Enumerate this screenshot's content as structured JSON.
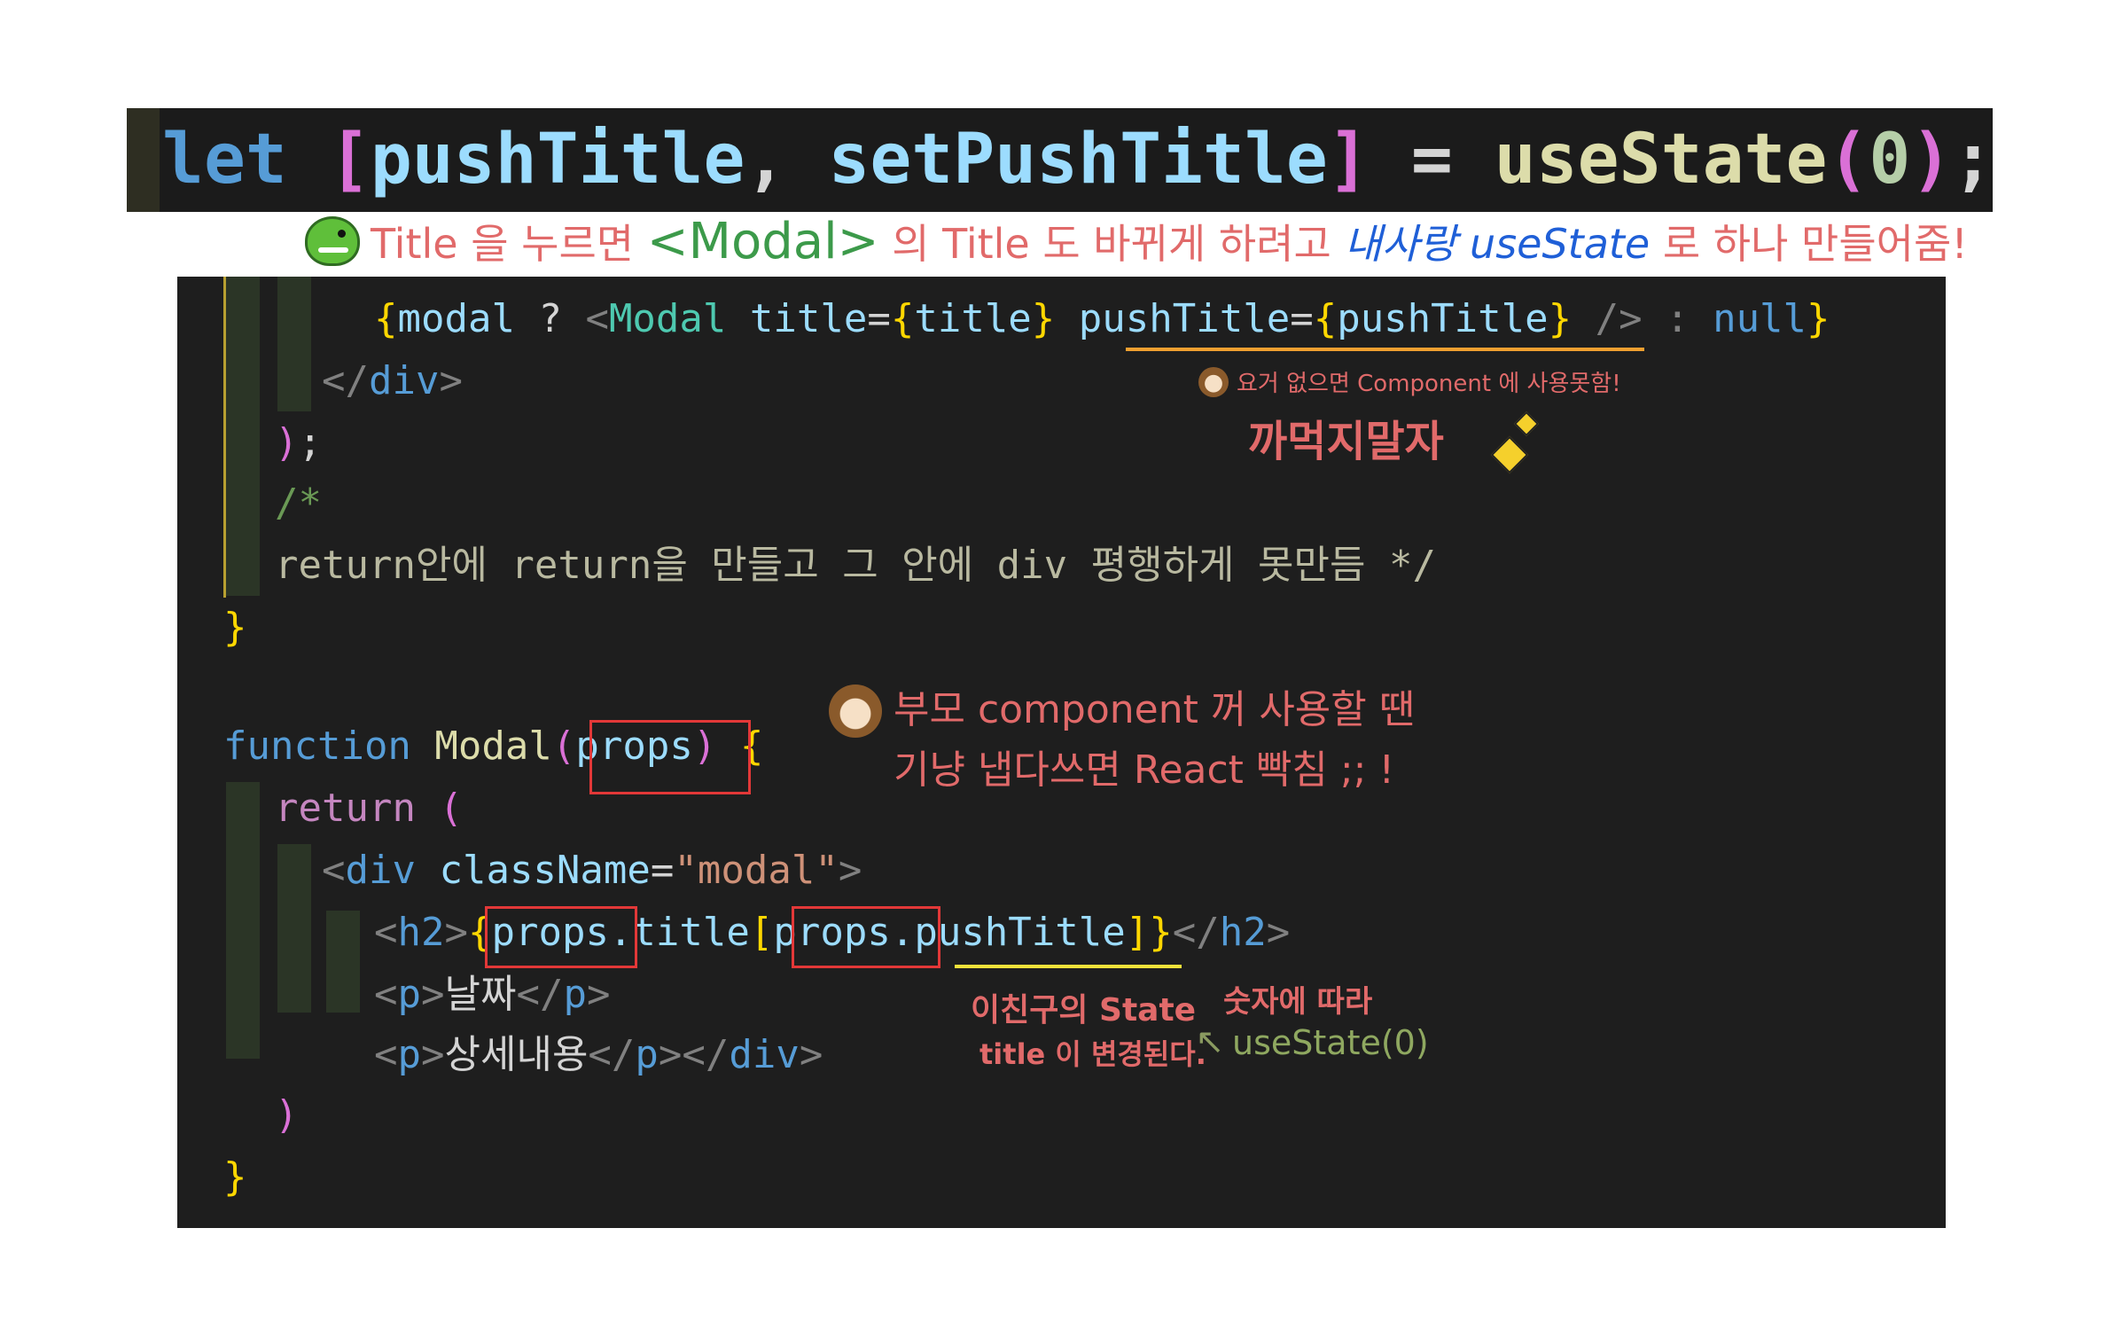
{
  "top_line": {
    "t_let": "let ",
    "t_open": "[",
    "t_var1": "pushTitle",
    "t_comma": ", ",
    "t_var2": "setPushTitle",
    "t_close": "]",
    "t_eq": " = ",
    "t_fn": "useState",
    "t_po": "(",
    "t_num": "0",
    "t_pc": ")",
    "t_semi": ";"
  },
  "caption": {
    "part1": "Title 을 누르면 ",
    "part2": "<Modal>",
    "part3": " 의 Title 도 바뀌게 하려고  ",
    "part4": "내사랑 useState",
    "part5": " 로 하나 만들어줌!"
  },
  "editor": {
    "l1": {
      "a": "{",
      "b": "modal",
      "c": " ? ",
      "d": "<",
      "e": "Modal",
      "f": " title",
      "g": "=",
      "h": "{",
      "i": "title",
      "j": "}",
      "k": " pushTitle",
      "l": "=",
      "m": "{",
      "n": "pushTitle",
      "o": "}",
      "p": " /> : ",
      "q": "null",
      "r": "}"
    },
    "l2": {
      "a": "</",
      "b": "div",
      "c": ">"
    },
    "l3": {
      "a": ")",
      "b": ";"
    },
    "l4": {
      "a": "/*"
    },
    "l5": {
      "a": "return안에 return을 만들고 그 안에 div 평행하게 못만듬 */"
    },
    "l6": {
      "a": "}"
    },
    "l7": {
      "a": "function",
      "b": " Modal",
      "c": "(",
      "d": "props",
      "e": ")",
      "f": " {"
    },
    "l8": {
      "a": "return",
      "b": " ("
    },
    "l9": {
      "a": "<",
      "b": "div",
      "c": " className",
      "d": "=",
      "e": "\"modal\"",
      "f": ">"
    },
    "l10": {
      "a": "<",
      "b": "h2",
      "c": ">",
      "d": "{",
      "e": "props",
      "f": ".title",
      "g": "[",
      "h": "props",
      "i": ".pushTitle",
      "j": "]",
      "k": "}",
      "l": "</",
      "m": "h2",
      "n": ">"
    },
    "l11": {
      "a": "<",
      "b": "p",
      "c": ">",
      "d": "날짜",
      "e": "</",
      "f": "p",
      "g": ">"
    },
    "l12": {
      "a": "<",
      "b": "p",
      "c": ">",
      "d": "상세내용",
      "e": "</",
      "f": "p",
      "g": "></",
      "h": "div",
      "i": ">"
    },
    "l13": {
      "a": ")"
    },
    "l14": {
      "a": "}"
    }
  },
  "annotations": {
    "no_omit": "요거 없으면 Component 에 사용못함!",
    "dont_forget": "까먹지말자",
    "parent1": "부모 component 꺼 사용할 땐",
    "parent2": "기냥 냅다쓰면 React 빡침 ;; !",
    "state1": "이친구의 State",
    "state2": "title 이 변경된다.",
    "num_label": "숫자에 따라",
    "usestate": "useState(0)"
  },
  "icons": {
    "dino": "dinosaur-sticker-icon",
    "squirrel": "chipmunk-sticker-icon",
    "sparkle": "sparkle-icon"
  },
  "colors": {
    "annotation_red": "#e16a6a",
    "annotation_green": "#4c9a2a",
    "annotation_blue": "#1f5fd7",
    "underline_orange": "#f0a030",
    "underline_yellow": "#f2e23a",
    "box_red": "#e23838"
  }
}
